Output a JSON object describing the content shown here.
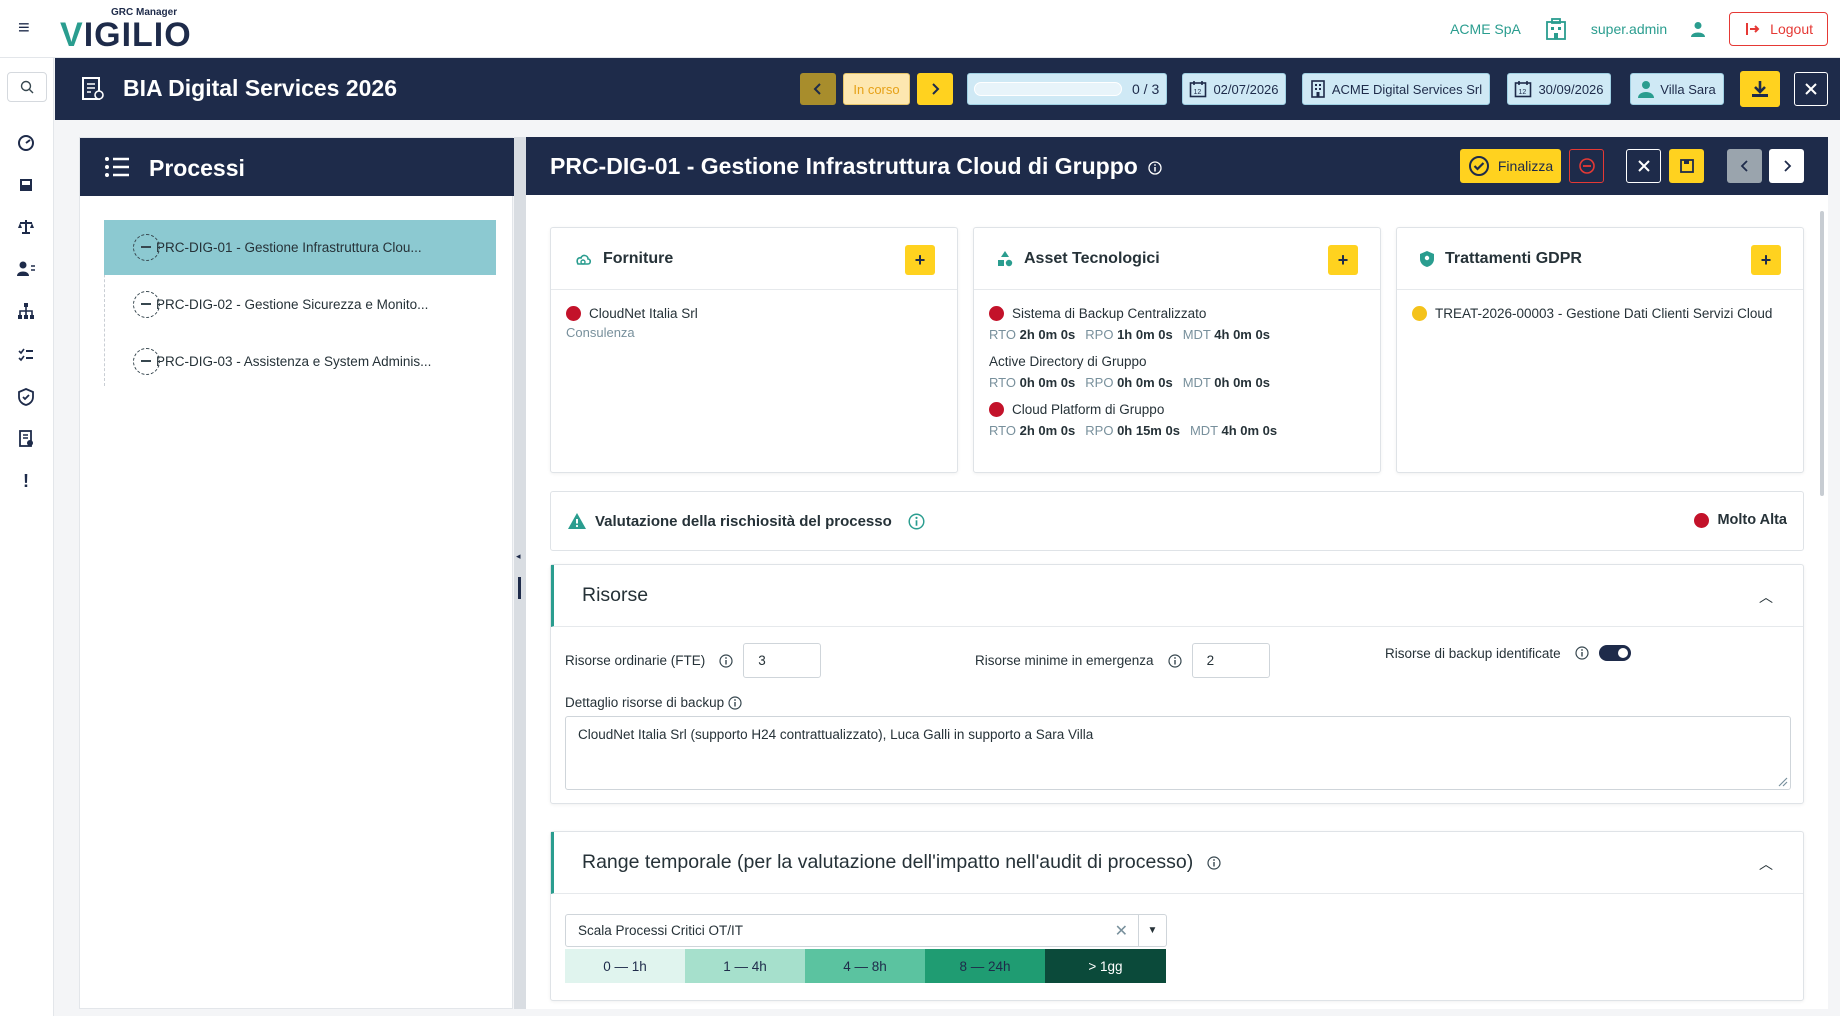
{
  "topbar": {
    "logo_sub": "GRC Manager",
    "logo_v": "V",
    "logo_rest": "IGILIO",
    "company": "ACME SpA",
    "user": "super.admin",
    "logout": "Logout"
  },
  "header": {
    "title": "BIA Digital Services 2026",
    "status": "In corso",
    "progress_text": "0 / 3",
    "progress_fraction": 0,
    "start_date": "02/07/2026",
    "org": "ACME Digital Services Srl",
    "end_date": "30/09/2026",
    "owner": "Villa Sara"
  },
  "processes": {
    "title": "Processi",
    "items": [
      {
        "label": "PRC-DIG-01 - Gestione Infrastruttura Clou...",
        "active": true
      },
      {
        "label": "PRC-DIG-02 - Gestione Sicurezza e Monito...",
        "active": false
      },
      {
        "label": "PRC-DIG-03 - Assistenza e System Adminis...",
        "active": false
      }
    ]
  },
  "detail": {
    "title": "PRC-DIG-01 - Gestione Infrastruttura Cloud di Gruppo",
    "finalize": "Finalizza",
    "forniture": {
      "title": "Forniture",
      "items": [
        {
          "name": "CloudNet Italia Srl",
          "sub": "Consulenza",
          "status": "red"
        }
      ]
    },
    "asset": {
      "title": "Asset Tecnologici",
      "rto_label": "RTO",
      "rpo_label": "RPO",
      "mdt_label": "MDT",
      "items": [
        {
          "name": "Sistema di Backup Centralizzato",
          "status": "red",
          "rto": "2h 0m 0s",
          "rpo": "1h 0m 0s",
          "mdt": "4h 0m 0s"
        },
        {
          "name": "Active Directory di Gruppo",
          "status": "none",
          "rto": "0h 0m 0s",
          "rpo": "0h 0m 0s",
          "mdt": "0h 0m 0s"
        },
        {
          "name": "Cloud Platform di Gruppo",
          "status": "red",
          "rto": "2h 0m 0s",
          "rpo": "0h 15m 0s",
          "mdt": "4h 0m 0s"
        }
      ]
    },
    "gdpr": {
      "title": "Trattamenti GDPR",
      "items": [
        {
          "name": "TREAT-2026-00003 - Gestione Dati Clienti Servizi Cloud",
          "status": "yellow"
        }
      ]
    },
    "risk": {
      "label": "Valutazione della rischiosità del processo",
      "level": "Molto Alta",
      "level_color": "#c3122a"
    },
    "resources": {
      "title": "Risorse",
      "ordinary_label": "Risorse ordinarie (FTE)",
      "ordinary_value": "3",
      "minimum_label": "Risorse minime in emergenza",
      "minimum_value": "2",
      "backup_label": "Risorse di backup identificate",
      "backup_on": true,
      "detail_label": "Dettaglio risorse di backup",
      "detail_value": "CloudNet Italia Srl (supporto H24 contrattualizzato), Luca Galli in supporto a Sara Villa"
    },
    "range": {
      "title": "Range temporale (per la valutazione dell'impatto nell'audit di processo)",
      "scale_selected": "Scala Processi Critici OT/IT",
      "segments": [
        {
          "label": "0 — 1h",
          "color": "#e0f4ee"
        },
        {
          "label": "1 — 4h",
          "color": "#a6e0cc"
        },
        {
          "label": "4 — 8h",
          "color": "#5bc3a0"
        },
        {
          "label": "8 — 24h",
          "color": "#1f9c72"
        },
        {
          "label": "> 1gg",
          "color": "#0b4a3a"
        }
      ]
    }
  }
}
